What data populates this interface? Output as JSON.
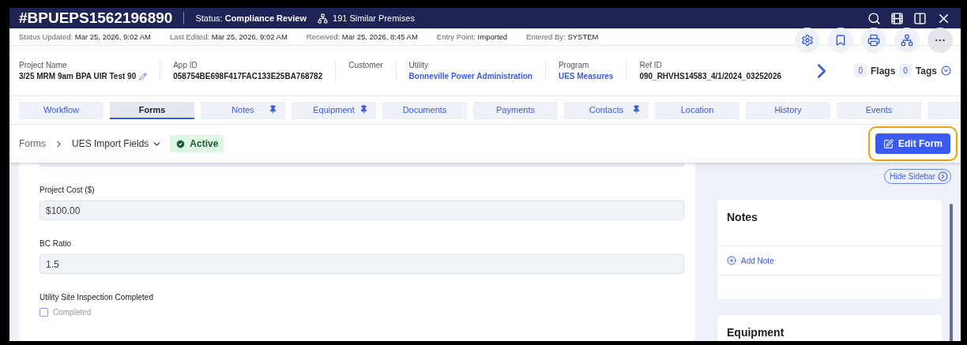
{
  "record": {
    "id": "#BPUEPS1562196890",
    "status_label": "Status:",
    "status": "Compliance Review",
    "similar": "191 Similar Premises"
  },
  "meta": [
    {
      "label": "Status Updated:",
      "value": "Mar 25, 2026, 9:02 AM"
    },
    {
      "label": "Last Edited:",
      "value": "Mar 25, 2026, 9:02 AM"
    },
    {
      "label": "Received:",
      "value": "Mar 25, 2026, 8:45 AM"
    },
    {
      "label": "Entry Point:",
      "value": "Imported"
    },
    {
      "label": "Entered By:",
      "value": "SYSTEM"
    }
  ],
  "info": [
    {
      "label": "Project Name",
      "value": "3/25 MRM 9am BPA UIR Test 90",
      "kind": "editable"
    },
    {
      "label": "App ID",
      "value": "058754BE698F417FAC133E25BA768782",
      "kind": "plain"
    },
    {
      "label": "Customer"
    },
    {
      "label": "Utility",
      "value": "Bonneville Power Administration",
      "kind": "link"
    },
    {
      "label": "Program",
      "value": "UES Measures",
      "kind": "link"
    },
    {
      "label": "Ref ID",
      "value": "090_RHVHS14583_4/1/2024_03252026",
      "kind": "plain"
    }
  ],
  "flags": {
    "count": "0",
    "label": "Flags"
  },
  "tags": {
    "count": "0",
    "label": "Tags"
  },
  "tabs": [
    {
      "label": "Workflow",
      "selected": false,
      "pinned": false
    },
    {
      "label": "Forms",
      "selected": true,
      "pinned": false
    },
    {
      "label": "Notes",
      "selected": false,
      "pinned": true
    },
    {
      "label": "Equipment",
      "selected": false,
      "pinned": true
    },
    {
      "label": "Documents",
      "selected": false,
      "pinned": false
    },
    {
      "label": "Payments",
      "selected": false,
      "pinned": false
    },
    {
      "label": "Contacts",
      "selected": false,
      "pinned": true
    },
    {
      "label": "Location",
      "selected": false,
      "pinned": false
    },
    {
      "label": "History",
      "selected": false,
      "pinned": false
    },
    {
      "label": "Events",
      "selected": false,
      "pinned": false
    }
  ],
  "breadcrumb": {
    "root": "Forms",
    "form": "UES Import Fields",
    "status": "Active"
  },
  "edit_button": {
    "label": "Edit Form",
    "highlighted": true
  },
  "fields": [
    {
      "kind": "text",
      "label": "Project Cost ($)",
      "value": "$100.00"
    },
    {
      "kind": "text",
      "label": "BC Ratio",
      "value": "1.5"
    },
    {
      "kind": "checkbox",
      "label": "Utility Site Inspection Completed",
      "option": "Completed",
      "checked": false
    }
  ],
  "sidebar": {
    "hide": "Hide Sidebar",
    "cards": [
      {
        "title": "Notes",
        "action": "Add Note"
      },
      {
        "title": "Equipment"
      }
    ]
  }
}
